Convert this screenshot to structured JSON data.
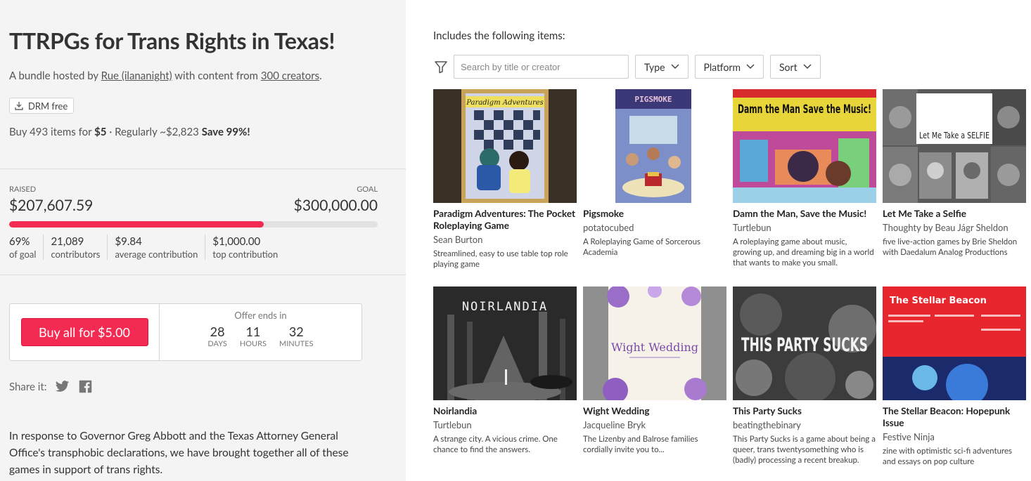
{
  "bundle": {
    "title": "TTRPGs for Trans Rights in Texas!",
    "hosted_prefix": "A bundle hosted by",
    "host": "Rue (ilananight)",
    "hosted_middle": "with content from",
    "creators_link": "300 creators",
    "hosted_suffix": ".",
    "drm_label": "DRM free",
    "buy_prefix": "Buy 493 items for",
    "buy_price": "$5",
    "buy_regular": "· Regularly ~$2,823",
    "buy_save": "Save 99%!"
  },
  "progress": {
    "raised_label": "RAISED",
    "raised_value": "$207,607.59",
    "goal_label": "GOAL",
    "goal_value": "$300,000.00",
    "percent": 69,
    "stats": [
      {
        "value": "69%",
        "label": "of goal"
      },
      {
        "value": "21,089",
        "label": "contributors"
      },
      {
        "value": "$9.84",
        "label": "average contribution"
      },
      {
        "value": "$1,000.00",
        "label": "top contribution"
      }
    ]
  },
  "purchase": {
    "button_label": "Buy all for $5.00",
    "offer_label": "Offer ends in",
    "countdown": [
      {
        "value": "28",
        "unit": "DAYS"
      },
      {
        "value": "11",
        "unit": "HOURS"
      },
      {
        "value": "32",
        "unit": "MINUTES"
      }
    ]
  },
  "share": {
    "label": "Share it:"
  },
  "description": "In response to Governor Greg Abbott and the Texas Attorney General Office's transphobic declarations, we have brought together all of these games in support of trans rights.",
  "items_section": {
    "heading": "Includes the following items:",
    "search_placeholder": "Search by title or creator",
    "filters": [
      "Type",
      "Platform",
      "Sort"
    ]
  },
  "items": [
    {
      "title": "Paradigm Adventures: The Pocket Roleplaying Game",
      "creator": "Sean Burton",
      "desc": "Streamlined, easy to use table top role playing game",
      "cover_text": "Paradigm Adventures"
    },
    {
      "title": "Pigsmoke",
      "creator": "potatocubed",
      "desc": "A Roleplaying Game of Sorcerous Academia",
      "cover_text": "PIGSMOKE"
    },
    {
      "title": "Damn the Man, Save the Music!",
      "creator": "Turtlebun",
      "desc": "A roleplaying game about music, growing up, and dreaming big in a world that wants to make you small.",
      "cover_text": "Damn the Man Save the Music!"
    },
    {
      "title": "Let Me Take a Selfie",
      "creator": "Thoughty by Beau Jágr Sheldon",
      "desc": "five live-action games by Brie Sheldon with Daedalum Analog Productions",
      "cover_text": "Let Me Take a SELFIE"
    },
    {
      "title": "Noirlandia",
      "creator": "Turtlebun",
      "desc": "A strange city. A vicious crime. One chance to find the answers.",
      "cover_text": "NOIRLANDIA"
    },
    {
      "title": "Wight Wedding",
      "creator": "Jacqueline Bryk",
      "desc": "The Lizenby and Balrose families cordially invite you to...",
      "cover_text": "Wight Wedding"
    },
    {
      "title": "This Party Sucks",
      "creator": "beatingthebinary",
      "desc": "This Party Sucks is a game about being a queer, trans twentysomething who is (badly) processing a recent breakup.",
      "cover_text": "THIS PARTY SUCKS"
    },
    {
      "title": "The Stellar Beacon: Hopepunk Issue",
      "creator": "Festive Ninja",
      "desc": "zine with optimistic sci-fi adventures and essays on pop culture",
      "cover_text": "The Stellar Beacon"
    }
  ],
  "colors": {
    "accent": "#f32a52",
    "left_bg": "#f4f4f4"
  }
}
